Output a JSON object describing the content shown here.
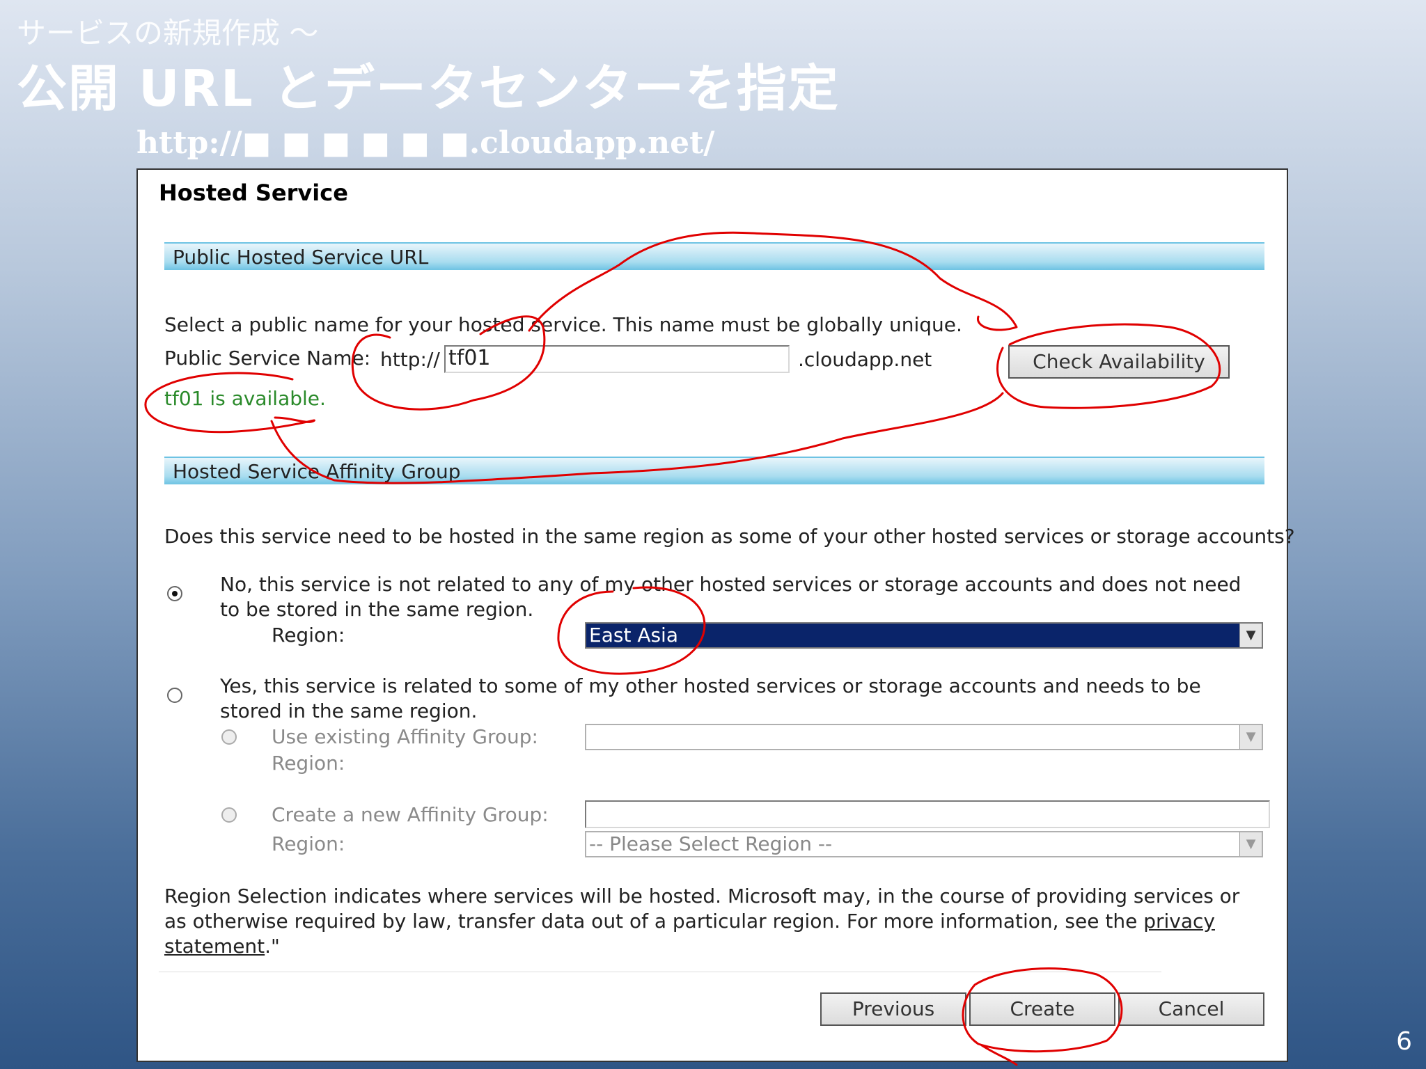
{
  "slide": {
    "subtitle": "サービスの新規作成 ～",
    "title": "公開 URL とデータセンターを指定",
    "url_pattern": "http://■ ■ ■ ■ ■ ■.cloudapp.net/",
    "page_number": "6"
  },
  "dialog": {
    "title": "Hosted Service",
    "url_section": {
      "header": "Public Hosted Service URL",
      "instruction": "Select a public name for your hosted service. This name must be globally unique.",
      "name_label": "Public Service Name:",
      "prefix": "http://",
      "name_value": "tf01",
      "suffix": ".cloudapp.net",
      "check_button": "Check Availability",
      "availability_message": "tf01 is available."
    },
    "affinity_section": {
      "header": "Hosted Service Affinity Group",
      "question": "Does this service need to be hosted in the same region as some of your other hosted services or storage accounts?",
      "option_no": "No, this service is not related to any of my other hosted services or storage accounts and does not need to be stored in the same region.",
      "region_label": "Region:",
      "region_value": "East Asia",
      "option_yes": "Yes, this service is related to some of my other hosted services or storage accounts and needs to be stored in the same region.",
      "use_existing_label": "Use existing Affinity Group:",
      "existing_region_label": "Region:",
      "create_new_label": "Create a new Affinity Group:",
      "new_region_label": "Region:",
      "new_region_placeholder": "-- Please Select Region --"
    },
    "footer_note_1": "Region Selection indicates where services will be hosted. Microsoft may, in the course of providing services or as otherwise required by law, transfer data out of a particular region. For more information, see the ",
    "privacy_link": "privacy statement",
    "footer_note_2": ".\"",
    "buttons": {
      "previous": "Previous",
      "create": "Create",
      "cancel": "Cancel"
    }
  },
  "colors": {
    "annotation_ink": "#e00000",
    "available_text": "#2a8a2a",
    "selected_bg": "#0a246a",
    "section_header": "#a8dcef"
  }
}
